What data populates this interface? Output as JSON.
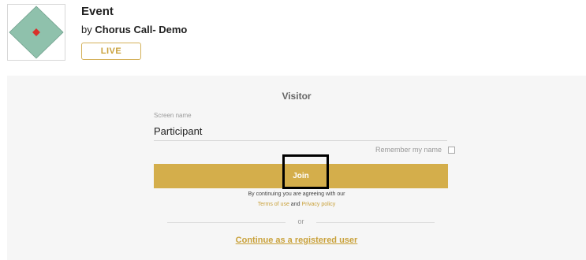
{
  "event": {
    "title": "Event",
    "by_prefix": "by",
    "organizer": "Chorus Call- Demo",
    "status_badge": "LIVE"
  },
  "login_panel": {
    "title": "Visitor",
    "screen_name_label": "Screen name",
    "screen_name_value": "Participant",
    "remember_label": "Remember my name",
    "join_label": "Join",
    "agree_text": "By continuing you are agreeing with our",
    "terms_link": "Terms of use",
    "and_text": "and",
    "privacy_link": "Privacy policy",
    "or_text": "or",
    "registered_link": "Continue as a registered user"
  },
  "colors": {
    "accent": "#d4ae4b",
    "logo_diamond": "#8fc1ac",
    "logo_dot": "#d9302a",
    "panel_bg": "#f6f6f6"
  },
  "icons": {
    "event_logo": "diamond-logo-icon",
    "remember_checkbox": "checkbox-unchecked-icon"
  }
}
